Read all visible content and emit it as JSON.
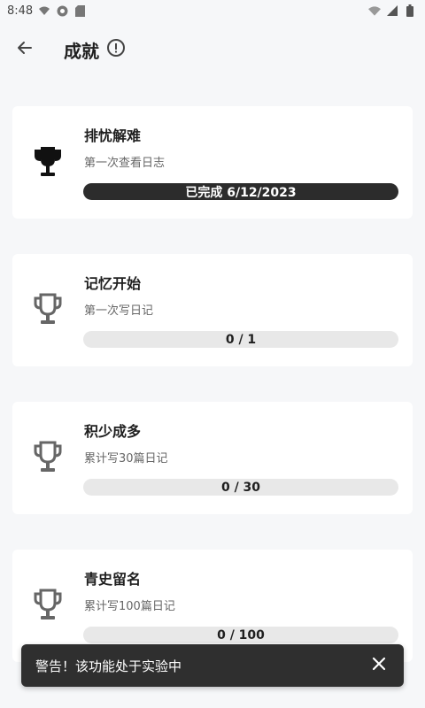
{
  "status_bar": {
    "time": "8:48",
    "icons_left": [
      "wifi-calling-icon",
      "vpn-icon",
      "sd-card-icon"
    ],
    "icons_right": [
      "wifi-icon",
      "signal-icon",
      "battery-icon"
    ]
  },
  "app_bar": {
    "title": "成就",
    "back_icon": "arrow-left-icon",
    "info_icon": "info-circle-icon"
  },
  "achievements": [
    {
      "title": "排忧解难",
      "description": "第一次查看日志",
      "progress_label": "已完成 6/12/2023",
      "completed": true
    },
    {
      "title": "记忆开始",
      "description": "第一次写日记",
      "progress_label": "0 / 1",
      "completed": false
    },
    {
      "title": "积少成多",
      "description": "累计写30篇日记",
      "progress_label": "0 / 30",
      "completed": false
    },
    {
      "title": "青史留名",
      "description": "累计写100篇日记",
      "progress_label": "0 / 100",
      "completed": false
    }
  ],
  "snackbar": {
    "message": "警告！该功能处于实验中",
    "close_icon": "close-icon"
  },
  "colors": {
    "background": "#f6f7f9",
    "card": "#ffffff",
    "completed_bar": "#2c2c2c",
    "pending_bar": "#e8e8e8",
    "trophy_done": "#111111",
    "trophy_pending": "#666666"
  }
}
